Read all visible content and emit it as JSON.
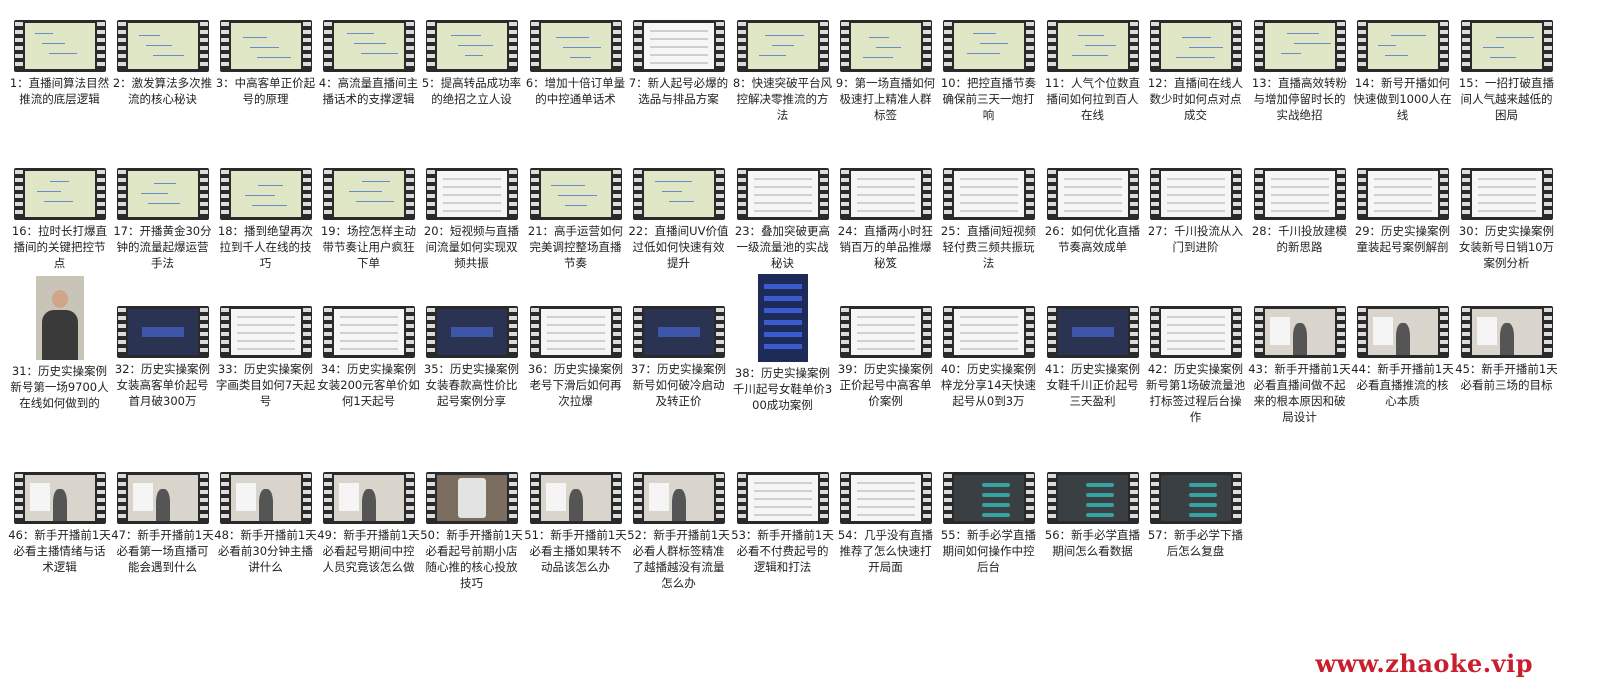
{
  "items": [
    {
      "label": "1：直播间算法目然推流的底层逻辑",
      "thumb": "mindmap"
    },
    {
      "label": "2：激发算法多次推流的核心秘诀",
      "thumb": "mindmap"
    },
    {
      "label": "3：中高客单正价起号的原理",
      "thumb": "mindmap"
    },
    {
      "label": "4：高流量直播间主播话术的支撑逻辑",
      "thumb": "mindmap"
    },
    {
      "label": "5：提高转品成功率的绝招之立人设",
      "thumb": "mindmap"
    },
    {
      "label": "6：增加十倍订单量的中控通单话术",
      "thumb": "mindmap"
    },
    {
      "label": "7：新人起号必爆的选品与排品方案",
      "thumb": "white"
    },
    {
      "label": "8：快速突破平台风控解决零推流的方法",
      "thumb": "mindmap"
    },
    {
      "label": "9：第一场直播如何极速打上精准人群标签",
      "thumb": "mindmap"
    },
    {
      "label": "10：把控直播节奏确保前三天一炮打响",
      "thumb": "mindmap"
    },
    {
      "label": "11：人气个位数直播间如何拉到百人在线",
      "thumb": "mindmap"
    },
    {
      "label": "12：直播间在线人数少时如何点对点成交",
      "thumb": "mindmap"
    },
    {
      "label": "13：直播高效转粉与增加停留时长的实战绝招",
      "thumb": "mindmap"
    },
    {
      "label": "14：新号开播如何快速做到1000人在线",
      "thumb": "mindmap"
    },
    {
      "label": "15：一招打破直播间人气越来越低的困局",
      "thumb": "mindmap"
    },
    {
      "label": "16：拉时长打爆直播间的关键把控节点",
      "thumb": "mindmap"
    },
    {
      "label": "17：开播黄金30分钟的流量起爆运营手法",
      "thumb": "mindmap"
    },
    {
      "label": "18：播到绝望再次拉到千人在线的技巧",
      "thumb": "mindmap"
    },
    {
      "label": "19：场控怎样主动带节奏让用户疯狂下单",
      "thumb": "mindmap"
    },
    {
      "label": "20：短视频与直播间流量如何实现双频共振",
      "thumb": "white"
    },
    {
      "label": "21：高手运营如何完美调控整场直播节奏",
      "thumb": "mindmap"
    },
    {
      "label": "22：直播间UV价值过低如何快速有效提升",
      "thumb": "mindmap"
    },
    {
      "label": "23：叠加突破更高一级流量池的实战秘诀",
      "thumb": "white"
    },
    {
      "label": "24：直播两小时狂销百万的单品推爆秘笈",
      "thumb": "white"
    },
    {
      "label": "25：直播间短视频轻付费三频共振玩法",
      "thumb": "white"
    },
    {
      "label": "26：如何优化直播节奏高效成单",
      "thumb": "white"
    },
    {
      "label": "27：千川投流从入门到进阶",
      "thumb": "white"
    },
    {
      "label": "28：千川投放建模的新思路",
      "thumb": "white"
    },
    {
      "label": "29：历史实操案例童装起号案例解剖",
      "thumb": "white"
    },
    {
      "label": "30：历史实操案例女装新号日销10万案例分析",
      "thumb": "white"
    },
    {
      "label": "31：历史实操案例新号第一场9700人在线如何做到的",
      "thumb": "portrait"
    },
    {
      "label": "32：历史实操案例女装高客单价起号首月破300万",
      "thumb": "dark"
    },
    {
      "label": "33：历史实操案例字画类目如何7天起号",
      "thumb": "white"
    },
    {
      "label": "34：历史实操案例女装200元客单价如何1天起号",
      "thumb": "white"
    },
    {
      "label": "35：历史实操案例女装春款高性价比起号案例分享",
      "thumb": "dark"
    },
    {
      "label": "36：历史实操案例老号下滑后如何再次拉爆",
      "thumb": "white"
    },
    {
      "label": "37：历史实操案例新号如何破冷启动及转正价",
      "thumb": "dark"
    },
    {
      "label": "38：历史实操案例千川起号女鞋单价300成功案例",
      "thumb": "tall"
    },
    {
      "label": "39：历史实操案例正价起号中高客单价案例",
      "thumb": "white"
    },
    {
      "label": "40：历史实操案例梓龙分享14天快速起号从0到3万",
      "thumb": "white"
    },
    {
      "label": "41：历史实操案例女鞋千川正价起号三天盈利",
      "thumb": "dark"
    },
    {
      "label": "42：历史实操案例新号第1场破流量池打标签过程后台操作",
      "thumb": "white"
    },
    {
      "label": "43：新手开播前1天必看直播间做不起来的根本原因和破局设计",
      "thumb": "person"
    },
    {
      "label": "44：新手开播前1天必看直播推流的核心本质",
      "thumb": "person"
    },
    {
      "label": "45：新手开播前1天必看前三场的目标",
      "thumb": "person"
    },
    {
      "label": "46：新手开播前1天必看主播情绪与话术逻辑",
      "thumb": "person"
    },
    {
      "label": "47：新手开播前1天必看第一场直播可能会遇到什么",
      "thumb": "person"
    },
    {
      "label": "48：新手开播前1天必看前30分钟主播讲什么",
      "thumb": "person"
    },
    {
      "label": "49：新手开播前1天必看起号期间中控人员究竟该怎么做",
      "thumb": "person"
    },
    {
      "label": "50：新手开播前1天必看起号前期小店随心推的核心投放技巧",
      "thumb": "phone"
    },
    {
      "label": "51：新手开播前1天必看主播如果转不动品该怎么办",
      "thumb": "person"
    },
    {
      "label": "52：新手开播前1天必看人群标签精准了越播越没有流量怎么办",
      "thumb": "person"
    },
    {
      "label": "53：新手开播前1天必看不付费起号的逻辑和打法",
      "thumb": "white"
    },
    {
      "label": "54：几乎没有直播推荐了怎么快速打开局面",
      "thumb": "white"
    },
    {
      "label": "55：新手必学直播期间如何操作中控后台",
      "thumb": "tree"
    },
    {
      "label": "56：新手必学直播期间怎么看数据",
      "thumb": "tree"
    },
    {
      "label": "57：新手必学下播后怎么复盘",
      "thumb": "tree"
    }
  ],
  "watermark": "www.zhaoke.vip"
}
